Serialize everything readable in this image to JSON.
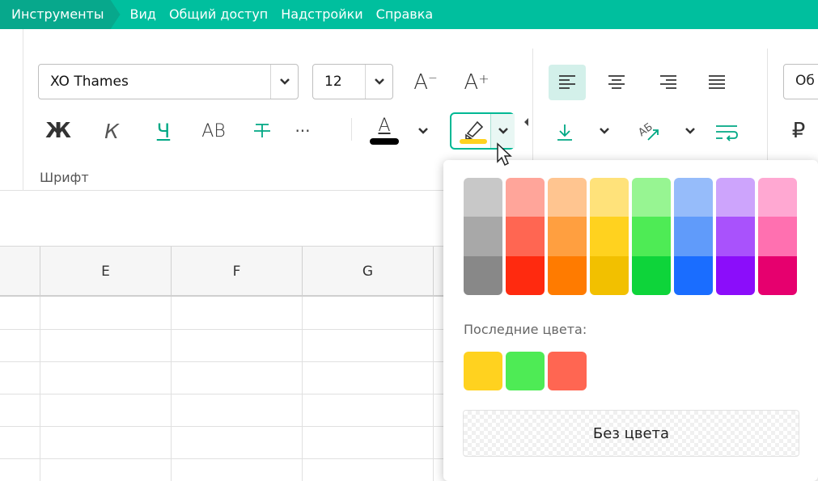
{
  "menubar": {
    "items": [
      "Инструменты",
      "Вид",
      "Общий доступ",
      "Надстройки",
      "Справка"
    ]
  },
  "ribbon": {
    "font_name": "XO Thames",
    "font_size": "12",
    "grow_label": "A",
    "shrink_label": "A",
    "bold": "Ж",
    "italic": "К",
    "underline": "Ч",
    "caps": "АВ",
    "more": "···",
    "font_color_letter": "A",
    "group_label": "Шрифт",
    "currency": "₽",
    "number_format_partial": "Об"
  },
  "grid": {
    "columns": [
      "E",
      "F",
      "G"
    ]
  },
  "color_popup": {
    "palette": [
      [
        "#c8c8c8",
        "#a8a8a8",
        "#888888"
      ],
      [
        "#ffa59a",
        "#ff6652",
        "#ff2a0f"
      ],
      [
        "#ffc590",
        "#ff9f40",
        "#ff7b00"
      ],
      [
        "#ffe27a",
        "#ffd21f",
        "#f2c000"
      ],
      [
        "#97f592",
        "#4eeb55",
        "#0ed43a"
      ],
      [
        "#96bcfa",
        "#609bfa",
        "#1a6dff"
      ],
      [
        "#cda4fc",
        "#a952fc",
        "#8b0dfa"
      ],
      [
        "#ffa8d2",
        "#ff70b0",
        "#e6006e"
      ]
    ],
    "recent_label": "Последние цвета:",
    "recent_colors": [
      "#ffd21f",
      "#4eeb55",
      "#ff6652"
    ],
    "no_color_label": "Без цвета"
  },
  "colors": {
    "accent": "#00bf9e",
    "highlight_yellow": "#ffd21f"
  }
}
